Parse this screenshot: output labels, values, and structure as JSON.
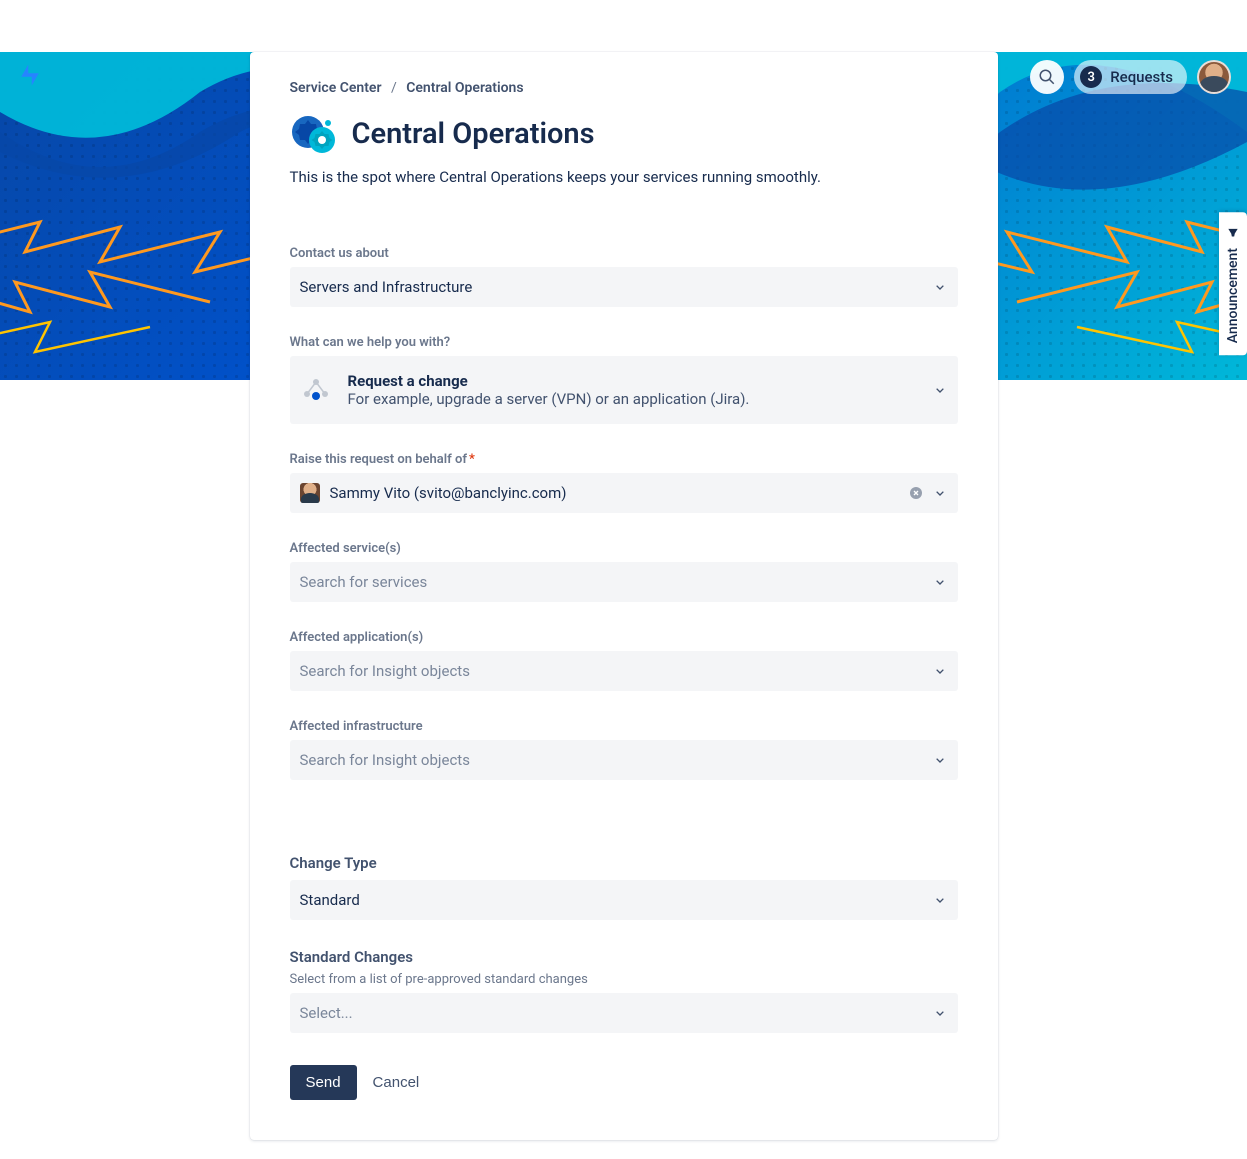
{
  "topbar": {
    "requests_count": "3",
    "requests_label": "Requests"
  },
  "breadcrumb": {
    "root": "Service Center",
    "current": "Central Operations"
  },
  "page": {
    "title": "Central Operations",
    "description": "This is the spot where Central Operations keeps your services running smoothly."
  },
  "announcement": {
    "label": "Announcement"
  },
  "form": {
    "contact_about": {
      "label": "Contact us about",
      "value": "Servers and Infrastructure"
    },
    "help_with": {
      "label": "What can we help you with?",
      "title": "Request a change",
      "description": "For example, upgrade a server (VPN) or an application (Jira)."
    },
    "on_behalf": {
      "label": "Raise this request on behalf of",
      "required": "*",
      "value": "Sammy Vito (svito@banclyinc.com)"
    },
    "affected_services": {
      "label": "Affected service(s)",
      "placeholder": "Search for services"
    },
    "affected_applications": {
      "label": "Affected application(s)",
      "placeholder": "Search for Insight objects"
    },
    "affected_infrastructure": {
      "label": "Affected infrastructure",
      "placeholder": "Search for Insight objects"
    },
    "change_type": {
      "label": "Change Type",
      "value": "Standard"
    },
    "standard_changes": {
      "label": "Standard Changes",
      "hint": "Select from a list of pre-approved standard changes",
      "placeholder": "Select..."
    },
    "actions": {
      "send": "Send",
      "cancel": "Cancel"
    }
  }
}
